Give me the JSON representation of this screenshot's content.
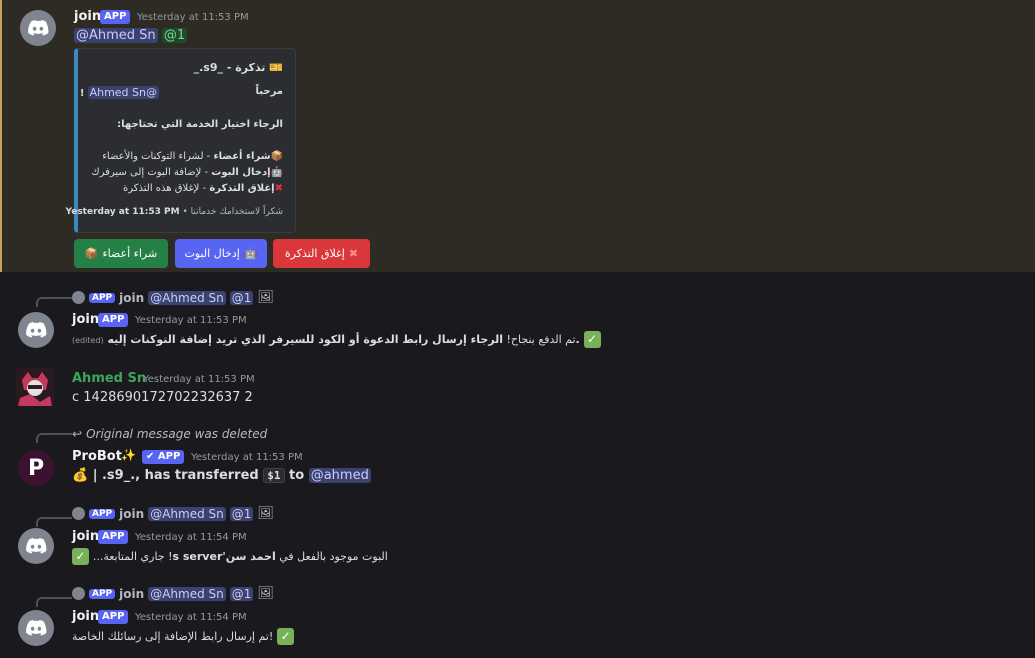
{
  "messages": {
    "m1": {
      "username": "join",
      "badge": "APP",
      "timestamp": "Yesterday at 11:53 PM",
      "mention_user": "@Ahmed Sn",
      "mention_role": "@1",
      "embed": {
        "title": "تذكرة - _s9._",
        "welcome": "مرحباً",
        "welcome_mention": "@Ahmed Sn",
        "welcome_mark": "!",
        "prompt": "الرجاء اختيار الخدمة التي تحتاجها:",
        "option1_bold": "شراء أعضاء",
        "option1_rest": " - لشراء التوكنات والأعضاء",
        "option2_bold": "إدخال البوت",
        "option2_rest": " - لإضافة البوت إلى سيرفرك",
        "option3_bold": "إغلاق التذكرة",
        "option3_rest": " - لإغلاق هذه التذكرة",
        "footer_text": "شكراً لاستخدامك خدماتنا",
        "footer_time": "Yesterday at 11:53 PM"
      },
      "buttons": {
        "buy": "شراء أعضاء",
        "add_bot": "إدخال البوت",
        "close": "إغلاق التذكرة"
      }
    },
    "m2": {
      "reply_user": "join",
      "reply_badge": "APP",
      "reply_mention_user": "@Ahmed Sn",
      "reply_mention_role": "@1",
      "username": "join",
      "badge": "APP",
      "timestamp": "Yesterday at 11:53 PM",
      "edited": "(edited)",
      "text_prefix": "تم الدفع بنجاح! ",
      "text_bold": "الرجاء إرسال رابط الدعوة أو الكود للسيرفر الذي تريد إضافة التوكنات إليه."
    },
    "m3": {
      "username": "Ahmed Sn",
      "timestamp": "Yesterday at 11:53 PM",
      "text": "c 1428690172702232637 2"
    },
    "m4": {
      "reply_text": "Original message was deleted",
      "username": "ProBot",
      "badge": "APP",
      "timestamp": "Yesterday at 11:53 PM",
      "text_a": "| .s9_., has transferred ",
      "amount": "$1",
      "text_b": " to ",
      "mention": "@ahmed"
    },
    "m5": {
      "reply_user": "join",
      "reply_badge": "APP",
      "reply_mention_user": "@Ahmed Sn",
      "reply_mention_role": "@1",
      "username": "join",
      "badge": "APP",
      "timestamp": "Yesterday at 11:54 PM",
      "text_a": "البوت موجود بالفعل في ",
      "text_bold": "احمد سن's server",
      "text_b": "! جاري المتابعة..."
    },
    "m6": {
      "reply_user": "join",
      "reply_badge": "APP",
      "reply_mention_user": "@Ahmed Sn",
      "reply_mention_role": "@1",
      "username": "join",
      "badge": "APP",
      "timestamp": "Yesterday at 11:54 PM",
      "text": "تم إرسال رابط الإضافة إلى رسائلك الخاصة!"
    }
  },
  "colors": {
    "app_badge": "#5865f2",
    "embed_border": "#3b88c3",
    "highlight_border": "#c9a15c",
    "username_green": "#3ba55d"
  }
}
